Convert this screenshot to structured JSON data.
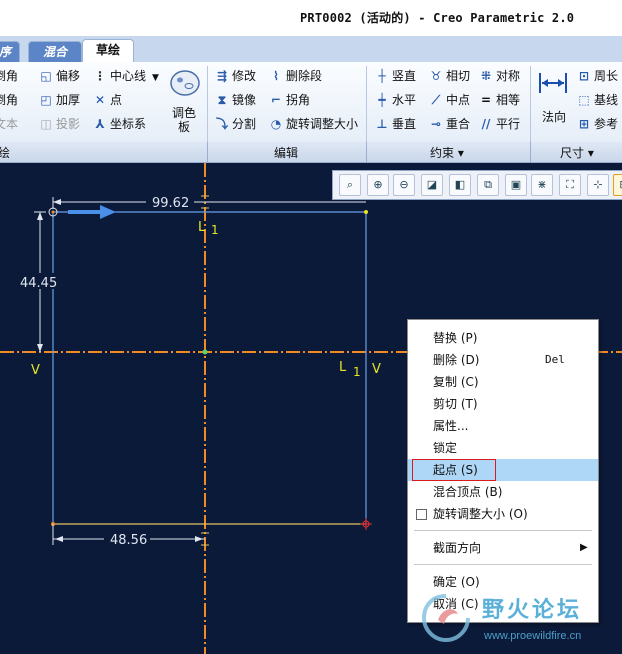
{
  "window": {
    "title": "PRT0002 (活动的) - Creo Parametric 2.0"
  },
  "tabs": {
    "left_partial": "序",
    "combo": "混合",
    "active": "草绘"
  },
  "ribbon": {
    "col1": [
      "倒角",
      "倒角",
      "文本"
    ],
    "col2": [
      "偏移",
      "加厚",
      "投影"
    ],
    "col3": [
      "中心线",
      "点",
      "坐标系"
    ],
    "palette": "调色板",
    "edit": [
      "修改",
      "删除段",
      "镜像",
      "拐角",
      "分割",
      "旋转调整大小"
    ],
    "constrain": [
      "竖直",
      "相切",
      "对称",
      "水平",
      "中点",
      "相等",
      "垂直",
      "重合",
      "平行"
    ],
    "normal": "法向",
    "dims": [
      "周长",
      "基线",
      "参考"
    ]
  },
  "groups": {
    "sketch": "绘",
    "edit": "编辑",
    "constrain": "约束 ▾",
    "dimension": "尺寸 ▾"
  },
  "view_toolbar": {
    "icons": [
      "zoom-fit-icon",
      "zoom-in-icon",
      "zoom-out-icon",
      "repaint-icon",
      "display-style-icon",
      "saved-views-icon",
      "sketch-view-icon",
      "constraint-display-icon",
      "dim-display-icon",
      "vertex-display-icon"
    ]
  },
  "sketch": {
    "dims": {
      "top": "99.62",
      "left": "44.45",
      "bottom": "48.56"
    },
    "labels": {
      "l_top": "L",
      "l_top_sub": "1",
      "l_right": "L",
      "l_right_sub": "1",
      "v_left": "V",
      "v_right": "V"
    },
    "colors": {
      "background": "#0c1a3a",
      "geometry": "#6a9fe6",
      "reference": "#f08a24",
      "dimension": "#e0e6f0",
      "constraint": "#e6e622"
    }
  },
  "context_menu": {
    "items": [
      {
        "label": "替换 (P)"
      },
      {
        "label": "删除 (D)",
        "shortcut": "Del"
      },
      {
        "label": "复制 (C)"
      },
      {
        "label": "剪切 (T)"
      },
      {
        "label": "属性..."
      },
      {
        "label": "锁定"
      },
      {
        "label": "起点 (S)"
      },
      {
        "label": "混合顶点 (B)"
      },
      {
        "label": "旋转调整大小 (O)"
      },
      {
        "label": "截面方向"
      },
      {
        "label": "确定 (O)"
      },
      {
        "label": "取消 (C)"
      }
    ]
  },
  "watermark": {
    "name": "野火论坛",
    "url": "www.proewildfire.cn"
  }
}
